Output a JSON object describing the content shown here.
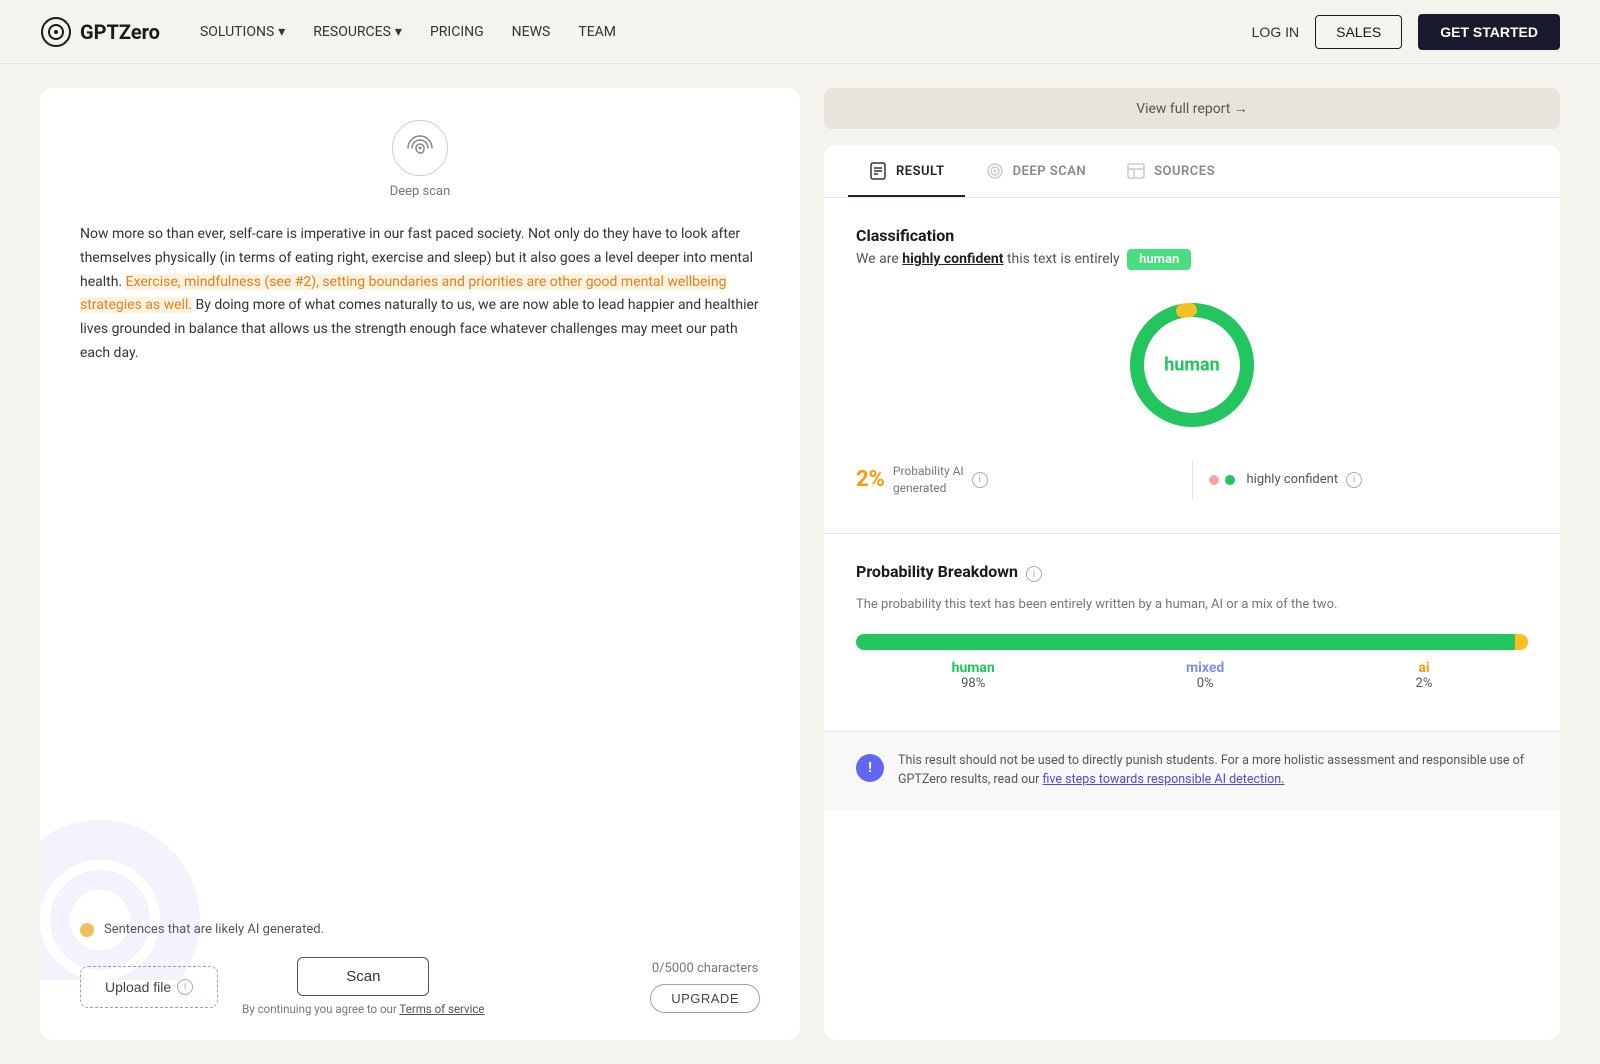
{
  "navbar": {
    "logo_text": "GPTZero",
    "nav_items": [
      {
        "label": "SOLUTIONS",
        "has_dropdown": true
      },
      {
        "label": "RESOURCES",
        "has_dropdown": true
      },
      {
        "label": "PRICING",
        "has_dropdown": false
      },
      {
        "label": "NEWS",
        "has_dropdown": false
      },
      {
        "label": "TEAM",
        "has_dropdown": false
      }
    ],
    "login_label": "LOG IN",
    "sales_label": "SALES",
    "get_started_label": "GET STARTED"
  },
  "left_panel": {
    "deep_scan_label": "Deep scan",
    "text_body": "Now more so than ever, self-care is imperative in our fast paced society. Not only do they have to look after themselves physically (in terms of eating right, exercise and sleep) but it also goes a level deeper into mental health. Exercise, mindfulness (see #2), setting boundaries and priorities are other good mental wellbeing strategies as well. By doing more of what comes naturally to us, we are now able to lead happier and healthier lives grounded in balance that allows us the strength enough face whatever challenges may meet our path each day.",
    "ai_notice": "Sentences that are likely AI generated.",
    "upload_label": "Upload file",
    "scan_label": "Scan",
    "terms_text": "By continuing you agree to our",
    "terms_link": "Terms of service",
    "char_count": "0/5000 characters",
    "upgrade_label": "UPGRADE"
  },
  "right_panel": {
    "view_full_report": "View full report →",
    "tabs": [
      {
        "label": "RESULT",
        "active": true
      },
      {
        "label": "DEEP SCAN",
        "active": false
      },
      {
        "label": "SOURCES",
        "active": false
      }
    ],
    "classification": {
      "title": "Classification",
      "description_pre": "We are",
      "description_bold": "highly confident",
      "description_mid": "this text is entirely",
      "badge": "human"
    },
    "donut": {
      "label": "human",
      "human_pct": 98,
      "ai_pct": 2
    },
    "stats": {
      "ai_pct": "2%",
      "ai_label": "Probability AI\ngenerated",
      "confidence_label": "highly confident"
    },
    "breakdown": {
      "title": "Probability Breakdown",
      "description": "The probability this text has been entirely written by a human, AI or a mix of the two.",
      "human_pct": 98,
      "mixed_pct": 0,
      "ai_pct": 2,
      "human_label": "human",
      "mixed_label": "mixed",
      "ai_label": "ai"
    },
    "disclaimer": {
      "text_pre": "This result should not be used to directly punish students. For a more holistic assessment and responsible use of GPTZero results, read our",
      "link_text": "five steps towards responsible AI detection.",
      "icon": "!"
    }
  }
}
